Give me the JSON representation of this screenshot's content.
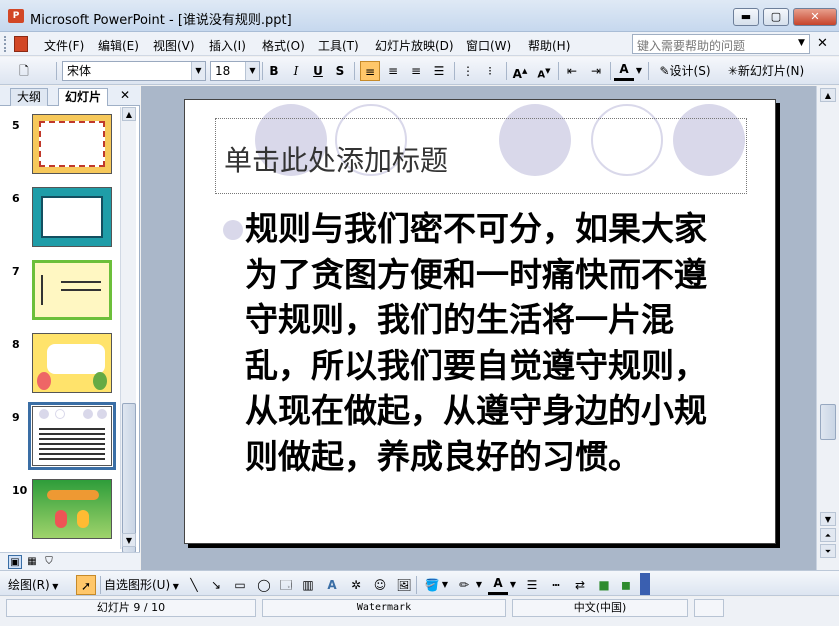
{
  "window": {
    "title": "Microsoft PowerPoint - [谁说没有规则.ppt]",
    "minimize": "▬",
    "maximize": "▢",
    "close": "✕"
  },
  "menu": {
    "items": [
      "文件(F)",
      "编辑(E)",
      "视图(V)",
      "插入(I)",
      "格式(O)",
      "工具(T)",
      "幻灯片放映(D)",
      "窗口(W)",
      "帮助(H)"
    ],
    "help_placeholder": "键入需要帮助的问题",
    "close_glyph": "✕"
  },
  "toolbar": {
    "font_name": "宋体",
    "font_size": "18",
    "bold": "B",
    "italic": "I",
    "underline": "U",
    "shadow": "S",
    "design_label": "设计(S)",
    "new_slide_label": "新幻灯片(N)",
    "font_color": "A"
  },
  "outline_tabs": {
    "outline": "大纲",
    "slides": "幻灯片",
    "close": "✕"
  },
  "thumbnails": [
    {
      "number": "5"
    },
    {
      "number": "6"
    },
    {
      "number": "7"
    },
    {
      "number": "8"
    },
    {
      "number": "9",
      "selected": true
    },
    {
      "number": "10"
    }
  ],
  "slide": {
    "title_placeholder": "单击此处添加标题",
    "body_text": "规则与我们密不可分，如果大家为了贪图方便和一时痛快而不遵守规则，我们的生活将一片混乱，所以我们要自觉遵守规则，从现在做起，从遵守身边的小规则做起，养成良好的习惯。",
    "accent_color": "#d9d8ea"
  },
  "drawbar": {
    "draw_label": "绘图(R)",
    "autoshapes_label": "自选图形(U)"
  },
  "status": {
    "slide_position": "幻灯片 9 / 10",
    "template": "Watermark",
    "language": "中文(中国)"
  }
}
